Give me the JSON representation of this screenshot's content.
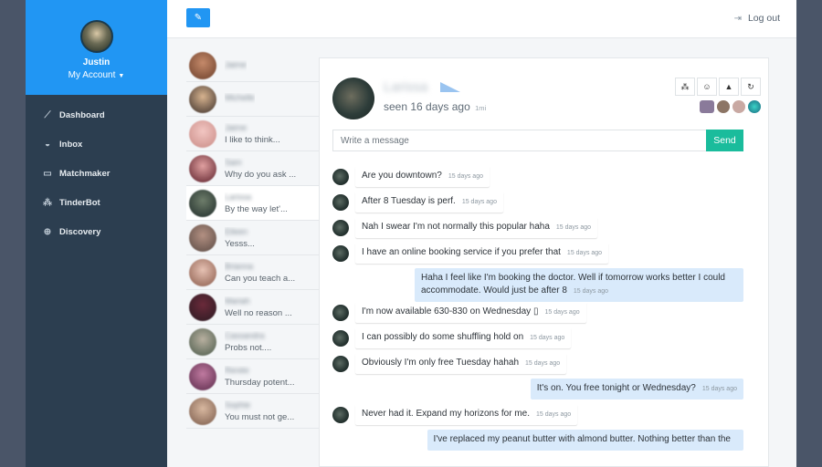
{
  "sidebar": {
    "user_name": "Justin",
    "account_label": "My Account",
    "account_caret": "▼",
    "items": [
      {
        "label": "Dashboard",
        "icon": "chart-line-icon",
        "glyph": "⟋"
      },
      {
        "label": "Inbox",
        "icon": "chat-bubbles-icon",
        "glyph": "◒"
      },
      {
        "label": "Matchmaker",
        "icon": "monitor-icon",
        "glyph": "▭"
      },
      {
        "label": "TinderBot",
        "icon": "cubes-icon",
        "glyph": "⁂"
      },
      {
        "label": "Discovery",
        "icon": "binoculars-icon",
        "glyph": "⊕"
      }
    ]
  },
  "topbar": {
    "compose_icon": "pencil-icon",
    "compose_glyph": "✎",
    "logout_label": "Log out",
    "logout_glyph": "⇥"
  },
  "conversations": [
    {
      "name": "Jaime",
      "preview": ""
    },
    {
      "name": "Michelle",
      "preview": ""
    },
    {
      "name": "Jaime",
      "preview": "I like to think..."
    },
    {
      "name": "Sam",
      "preview": "Why do you ask ..."
    },
    {
      "name": "Larissa",
      "preview": "By the way let'...",
      "active": true
    },
    {
      "name": "Eileen",
      "preview": "Yesss..."
    },
    {
      "name": "Brianna",
      "preview": "Can you teach a..."
    },
    {
      "name": "Mariah",
      "preview": "Well no reason ..."
    },
    {
      "name": "Cassandra",
      "preview": "Probs not...."
    },
    {
      "name": "Renée",
      "preview": "Thursday potent..."
    },
    {
      "name": "Sophie",
      "preview": "You must not ge..."
    }
  ],
  "chat": {
    "match_name": "Larissa",
    "seen_text": "seen 16 days ago",
    "distance": "1mi",
    "actions": [
      {
        "name": "cubes-action-icon",
        "glyph": "⁂"
      },
      {
        "name": "smiley-action-icon",
        "glyph": "☺"
      },
      {
        "name": "warning-action-icon",
        "glyph": "▲"
      },
      {
        "name": "refresh-action-icon",
        "glyph": "↻"
      }
    ],
    "composer_placeholder": "Write a message",
    "send_label": "Send",
    "messages": [
      {
        "dir": "in",
        "text": "Are you downtown?",
        "time": "15 days ago"
      },
      {
        "dir": "in",
        "text": "After 8 Tuesday is perf.",
        "time": "15 days ago"
      },
      {
        "dir": "in",
        "text": "Nah I swear I'm not normally this popular haha",
        "time": "15 days ago"
      },
      {
        "dir": "in",
        "text": "I have an online booking service if you prefer that",
        "time": "15 days ago"
      },
      {
        "dir": "out",
        "text": "Haha I feel like I'm booking the doctor. Well if tomorrow works better I could accommodate. Would just be after 8",
        "time": "15 days ago"
      },
      {
        "dir": "in",
        "text": "I'm now available 630-830 on Wednesday ▯",
        "time": "15 days ago"
      },
      {
        "dir": "in",
        "text": "I can possibly do some shuffling hold on",
        "time": "15 days ago"
      },
      {
        "dir": "in",
        "text": "Obviously I'm only free Tuesday hahah",
        "time": "15 days ago"
      },
      {
        "dir": "out",
        "text": "It's on. You free tonight or Wednesday?",
        "time": "15 days ago"
      },
      {
        "dir": "in",
        "text": "Never had it. Expand my horizons for me.",
        "time": "15 days ago"
      },
      {
        "dir": "out",
        "text": "I've replaced my peanut butter with almond butter. Nothing better than the",
        "time": ""
      }
    ]
  },
  "colors": {
    "accent": "#2196f3",
    "sidebar_bg": "#2c3e50",
    "send": "#1abc9c",
    "outgoing_bubble": "#d9eafb"
  }
}
